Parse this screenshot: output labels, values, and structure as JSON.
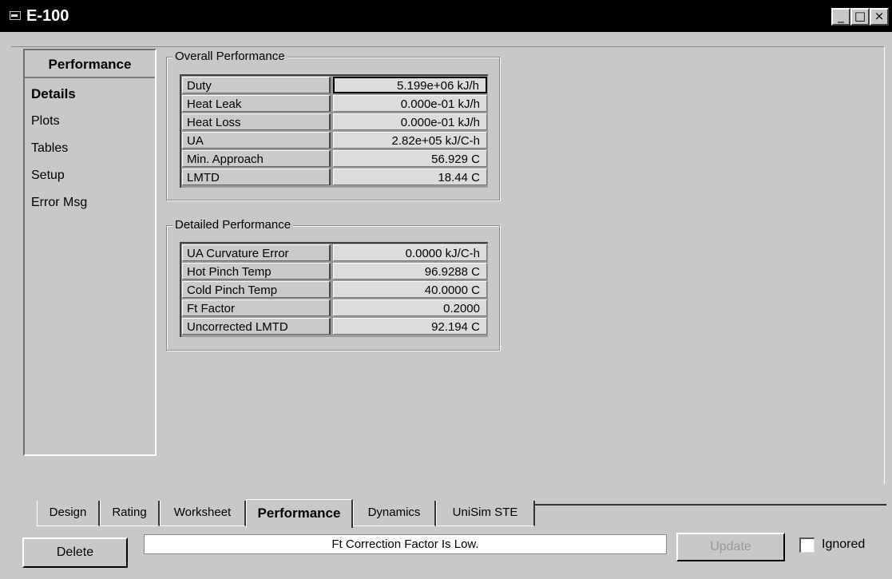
{
  "window": {
    "title": "E-100",
    "minimize_glyph": "_",
    "maximize_glyph": "□",
    "close_glyph": "×"
  },
  "navigator": {
    "header": "Performance",
    "items": [
      {
        "label": "Details",
        "selected": true
      },
      {
        "label": "Plots",
        "selected": false
      },
      {
        "label": "Tables",
        "selected": false
      },
      {
        "label": "Setup",
        "selected": false
      },
      {
        "label": "Error Msg",
        "selected": false
      }
    ]
  },
  "overall": {
    "title": "Overall Performance",
    "rows": [
      {
        "label": "Duty",
        "value": "5.199e+06 kJ/h"
      },
      {
        "label": "Heat Leak",
        "value": "0.000e-01 kJ/h"
      },
      {
        "label": "Heat Loss",
        "value": "0.000e-01 kJ/h"
      },
      {
        "label": "UA",
        "value": "2.82e+05 kJ/C-h"
      },
      {
        "label": "Min. Approach",
        "value": "56.929 C"
      },
      {
        "label": "LMTD",
        "value": "18.44 C"
      }
    ]
  },
  "detailed": {
    "title": "Detailed Performance",
    "rows": [
      {
        "label": "UA Curvature Error",
        "value": "0.0000 kJ/C-h"
      },
      {
        "label": "Hot Pinch Temp",
        "value": "96.9288 C"
      },
      {
        "label": "Cold Pinch Temp",
        "value": "40.0000 C"
      },
      {
        "label": "Ft Factor",
        "value": "0.2000"
      },
      {
        "label": "Uncorrected LMTD",
        "value": "92.194 C"
      }
    ]
  },
  "tabs": [
    {
      "label": "Design",
      "active": false
    },
    {
      "label": "Rating",
      "active": false
    },
    {
      "label": "Worksheet",
      "active": false
    },
    {
      "label": "Performance",
      "active": true
    },
    {
      "label": "Dynamics",
      "active": false
    },
    {
      "label": "UniSim STE",
      "active": false
    }
  ],
  "footer": {
    "delete_label": "Delete",
    "status_message": "Ft Correction Factor Is Low.",
    "update_label": "Update",
    "ignored_label": "Ignored",
    "ignored_checked": false
  },
  "colors": {
    "title_bar": "#000000",
    "window_face": "#c8c8c8",
    "grid_value": "#dcdcdc",
    "status_field": "#ffffff",
    "disabled_text": "#999999"
  },
  "icons": [
    "window-icon",
    "minimize-icon",
    "maximize-icon",
    "close-icon",
    "checkbox-icon"
  ]
}
